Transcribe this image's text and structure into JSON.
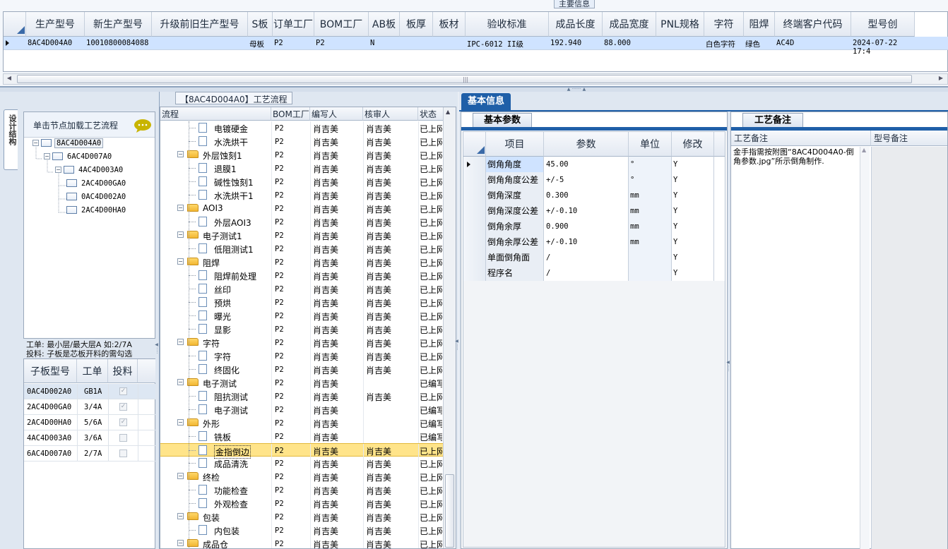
{
  "top": {
    "section_title": "主要信息",
    "columns": [
      "生产型号",
      "新生产型号",
      "升级前旧生产型号",
      "S板",
      "订单工厂",
      "BOM工厂",
      "AB板",
      "板厚",
      "板材",
      "验收标准",
      "成品长度",
      "成品宽度",
      "PNL规格",
      "字符",
      "阻焊",
      "终端客户代码",
      "型号创"
    ],
    "row": [
      "8AC4D004A0",
      "10010800084088",
      "",
      "母板",
      "P2",
      "P2",
      "N",
      "",
      "",
      "IPC-6012 II级",
      "192.940",
      "88.000",
      "",
      "白色字符",
      "绿色",
      "AC4D",
      "2024-07-22 17:4"
    ]
  },
  "left": {
    "vertical_tab": "设计结构",
    "tree_header": "单击节点加载工艺流程",
    "tree_nodes": [
      "8AC4D004A0",
      "6AC4D007A0",
      "4AC4D003A0",
      "2AC4D00GA0",
      "0AC4D002A0",
      "2AC4D00HA0"
    ],
    "note_line1": "工单: 最小层/最大层A 如:2/7A",
    "note_line2": "投料: 子板是芯板开料的需勾选",
    "sub_columns": [
      "子板型号",
      "工单",
      "投料"
    ],
    "sub_rows": [
      {
        "model": "0AC4D002A0",
        "order": "GB1A",
        "feed": true
      },
      {
        "model": "2AC4D00GA0",
        "order": "3/4A",
        "feed": true
      },
      {
        "model": "2AC4D00HA0",
        "order": "5/6A",
        "feed": true
      },
      {
        "model": "4AC4D003A0",
        "order": "3/6A",
        "feed": false
      },
      {
        "model": "6AC4D007A0",
        "order": "2/7A",
        "feed": false
      }
    ]
  },
  "process": {
    "title": "【8AC4D004A0】工艺流程",
    "columns": [
      "流程",
      "BOM工厂",
      "编写人",
      "核审人",
      "状态"
    ],
    "rows": [
      {
        "name": "电镀硬金",
        "folder": false,
        "bom": "P2",
        "writer": "肖吉美",
        "reviewer": "肖吉美",
        "status": "已上网"
      },
      {
        "name": "水洗烘干",
        "folder": false,
        "bom": "P2",
        "writer": "肖吉美",
        "reviewer": "肖吉美",
        "status": "已上网"
      },
      {
        "name": "外层蚀刻1",
        "folder": true,
        "bom": "P2",
        "writer": "肖吉美",
        "reviewer": "肖吉美",
        "status": "已上网"
      },
      {
        "name": "退膜1",
        "folder": false,
        "bom": "P2",
        "writer": "肖吉美",
        "reviewer": "肖吉美",
        "status": "已上网"
      },
      {
        "name": "碱性蚀刻1",
        "folder": false,
        "bom": "P2",
        "writer": "肖吉美",
        "reviewer": "肖吉美",
        "status": "已上网"
      },
      {
        "name": "水洗烘干1",
        "folder": false,
        "bom": "P2",
        "writer": "肖吉美",
        "reviewer": "肖吉美",
        "status": "已上网"
      },
      {
        "name": "AOI3",
        "folder": true,
        "bom": "P2",
        "writer": "肖吉美",
        "reviewer": "肖吉美",
        "status": "已上网"
      },
      {
        "name": "外层AOI3",
        "folder": false,
        "bom": "P2",
        "writer": "肖吉美",
        "reviewer": "肖吉美",
        "status": "已上网"
      },
      {
        "name": "电子测试1",
        "folder": true,
        "bom": "P2",
        "writer": "肖吉美",
        "reviewer": "肖吉美",
        "status": "已上网"
      },
      {
        "name": "低阻测试1",
        "folder": false,
        "bom": "P2",
        "writer": "肖吉美",
        "reviewer": "肖吉美",
        "status": "已上网"
      },
      {
        "name": "阻焊",
        "folder": true,
        "bom": "P2",
        "writer": "肖吉美",
        "reviewer": "肖吉美",
        "status": "已上网"
      },
      {
        "name": "阻焊前处理",
        "folder": false,
        "bom": "P2",
        "writer": "肖吉美",
        "reviewer": "肖吉美",
        "status": "已上网"
      },
      {
        "name": "丝印",
        "folder": false,
        "bom": "P2",
        "writer": "肖吉美",
        "reviewer": "肖吉美",
        "status": "已上网"
      },
      {
        "name": "预烘",
        "folder": false,
        "bom": "P2",
        "writer": "肖吉美",
        "reviewer": "肖吉美",
        "status": "已上网"
      },
      {
        "name": "曝光",
        "folder": false,
        "bom": "P2",
        "writer": "肖吉美",
        "reviewer": "肖吉美",
        "status": "已上网"
      },
      {
        "name": "显影",
        "folder": false,
        "bom": "P2",
        "writer": "肖吉美",
        "reviewer": "肖吉美",
        "status": "已上网"
      },
      {
        "name": "字符",
        "folder": true,
        "bom": "P2",
        "writer": "肖吉美",
        "reviewer": "肖吉美",
        "status": "已上网"
      },
      {
        "name": "字符",
        "folder": false,
        "bom": "P2",
        "writer": "肖吉美",
        "reviewer": "肖吉美",
        "status": "已上网"
      },
      {
        "name": "终固化",
        "folder": false,
        "bom": "P2",
        "writer": "肖吉美",
        "reviewer": "肖吉美",
        "status": "已上网"
      },
      {
        "name": "电子测试",
        "folder": true,
        "bom": "P2",
        "writer": "肖吉美",
        "reviewer": "",
        "status": "已编写"
      },
      {
        "name": "阻抗测试",
        "folder": false,
        "bom": "P2",
        "writer": "肖吉美",
        "reviewer": "肖吉美",
        "status": "已上网"
      },
      {
        "name": "电子测试",
        "folder": false,
        "bom": "P2",
        "writer": "肖吉美",
        "reviewer": "",
        "status": "已编写"
      },
      {
        "name": "外形",
        "folder": true,
        "bom": "P2",
        "writer": "肖吉美",
        "reviewer": "",
        "status": "已编写"
      },
      {
        "name": "铣板",
        "folder": false,
        "bom": "P2",
        "writer": "肖吉美",
        "reviewer": "",
        "status": "已编写"
      },
      {
        "name": "金指倒边",
        "folder": false,
        "bom": "P2",
        "writer": "肖吉美",
        "reviewer": "肖吉美",
        "status": "已上网"
      },
      {
        "name": "成品清洗",
        "folder": false,
        "bom": "P2",
        "writer": "肖吉美",
        "reviewer": "肖吉美",
        "status": "已上网"
      },
      {
        "name": "终检",
        "folder": true,
        "bom": "P2",
        "writer": "肖吉美",
        "reviewer": "肖吉美",
        "status": "已上网"
      },
      {
        "name": "功能检查",
        "folder": false,
        "bom": "P2",
        "writer": "肖吉美",
        "reviewer": "肖吉美",
        "status": "已上网"
      },
      {
        "name": "外观检查",
        "folder": false,
        "bom": "P2",
        "writer": "肖吉美",
        "reviewer": "肖吉美",
        "status": "已上网"
      },
      {
        "name": "包装",
        "folder": true,
        "bom": "P2",
        "writer": "肖吉美",
        "reviewer": "肖吉美",
        "status": "已上网"
      },
      {
        "name": "内包装",
        "folder": false,
        "bom": "P2",
        "writer": "肖吉美",
        "reviewer": "肖吉美",
        "status": "已上网"
      },
      {
        "name": "成品仓",
        "folder": true,
        "bom": "P2",
        "writer": "肖吉美",
        "reviewer": "肖吉美",
        "status": "已上网"
      }
    ],
    "selected_index": 24
  },
  "basic": {
    "tab": "基本信息",
    "params_tab": "基本参数",
    "columns": [
      "项目",
      "参数",
      "单位",
      "修改"
    ],
    "rows": [
      {
        "item": "倒角角度",
        "value": "45.00",
        "unit": "°",
        "mod": "Y"
      },
      {
        "item": "倒角角度公差",
        "value": "+/-5",
        "unit": "°",
        "mod": "Y"
      },
      {
        "item": "倒角深度",
        "value": "0.300",
        "unit": "mm",
        "mod": "Y"
      },
      {
        "item": "倒角深度公差",
        "value": "+/-0.10",
        "unit": "mm",
        "mod": "Y"
      },
      {
        "item": "倒角余厚",
        "value": "0.900",
        "unit": "mm",
        "mod": "Y"
      },
      {
        "item": "倒角余厚公差",
        "value": "+/-0.10",
        "unit": "mm",
        "mod": "Y"
      },
      {
        "item": "单面倒角面",
        "value": "/",
        "unit": "",
        "mod": "Y"
      },
      {
        "item": "程序名",
        "value": "/",
        "unit": "",
        "mod": "Y"
      }
    ]
  },
  "remarks": {
    "tab": "工艺备注",
    "col1": "工艺备注",
    "col2": "型号备注",
    "text": "金手指需按附图“8AC4D004A0-倒角参数.jpg”所示倒角制作."
  },
  "colors": {
    "accent": "#1f5fa8",
    "selected_row": "#cfe3ff",
    "highlight_row": "#ffe48a"
  }
}
